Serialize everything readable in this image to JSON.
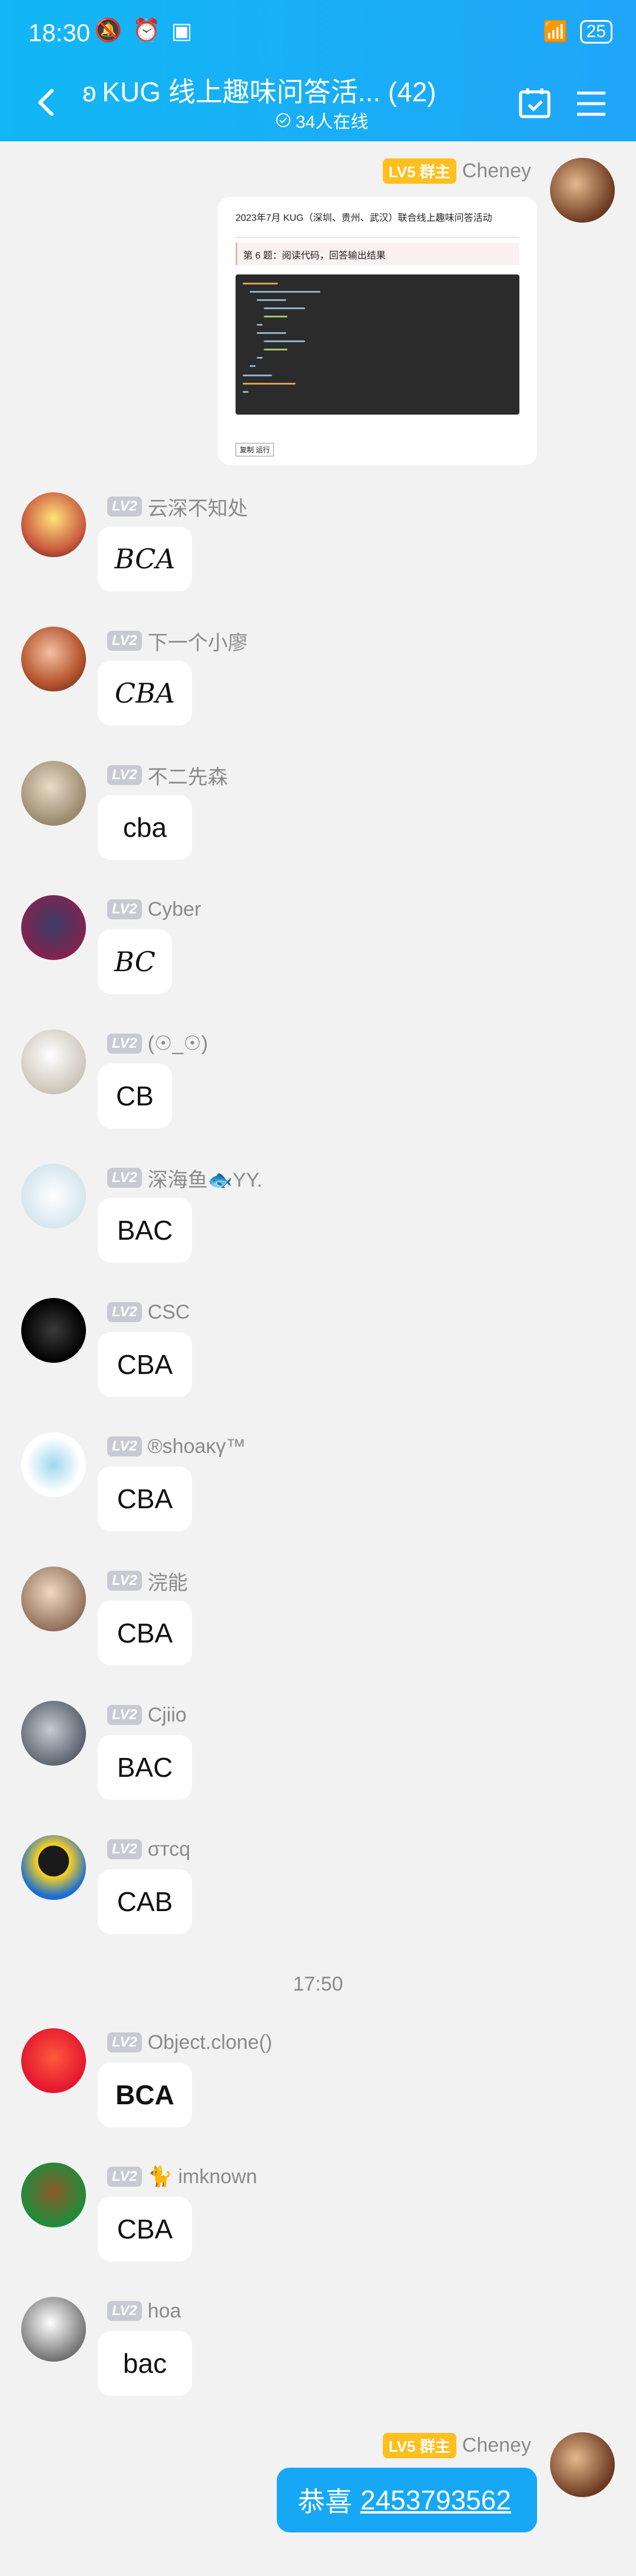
{
  "status_bar": {
    "time": "18:30",
    "battery": "25"
  },
  "header": {
    "title": "KUG 线上趣味问答活... (42)",
    "online": "34人在线"
  },
  "owner_badge": "LV5 群主",
  "first_message": {
    "sender": "Cheney",
    "image": {
      "title": "2023年7月 KUG（深圳、贵州、武汉）联合线上趣味问答活动",
      "question": "第 6 题：阅读代码，回答输出结果",
      "button": "复制 运行"
    }
  },
  "level_badge": "LV2",
  "messages": [
    {
      "name": "云深不知处",
      "text": "BCA",
      "style": "script"
    },
    {
      "name": "下一个小廖",
      "text": "CBA",
      "style": "script"
    },
    {
      "name": "不二先森",
      "text": "cba",
      "style": "normal"
    },
    {
      "name": "Cyber",
      "text": "BC",
      "style": "script"
    },
    {
      "name": "(☉_☉)",
      "text": "CB",
      "style": "normal"
    },
    {
      "name": "深海鱼🐟YY.",
      "text": "BAC",
      "style": "normal"
    },
    {
      "name": "CSC",
      "text": "CBA",
      "style": "normal"
    },
    {
      "name": "®shoaκγ™",
      "text": "CBA",
      "style": "normal"
    },
    {
      "name": "浣能",
      "text": "CBA",
      "style": "normal"
    },
    {
      "name": "Cjiio",
      "text": "BAC",
      "style": "normal"
    },
    {
      "name": "σтcq",
      "text": "CAB",
      "style": "normal"
    }
  ],
  "time_separator": "17:50",
  "messages_after": [
    {
      "name": "Object.clone()",
      "text": "BCA",
      "style": "bold"
    },
    {
      "name": "🐈 imknown",
      "text": "CBA",
      "style": "normal"
    },
    {
      "name": "hoa",
      "text": "bac",
      "style": "normal"
    }
  ],
  "last_message": {
    "sender": "Cheney",
    "text": "恭喜",
    "number": "2453793562"
  },
  "colors": {
    "header": "#12b7f5",
    "bubble_self": "#17a8f5",
    "owner_badge": "#ffbf1f"
  }
}
